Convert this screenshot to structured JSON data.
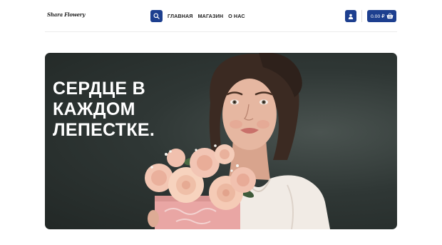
{
  "header": {
    "logo_text": "Shara Flowery",
    "nav": [
      "ГЛАВНАЯ",
      "МАГАЗИН",
      "О НАС"
    ],
    "cart_total": "0.00 ₽"
  },
  "hero": {
    "title_lines": [
      "СЕРДЦЕ В",
      "КАЖДОМ",
      "ЛЕПЕСТКЕ."
    ]
  },
  "icons": {
    "search": "search-icon",
    "account": "user-icon",
    "cart": "basket-icon"
  },
  "colors": {
    "accent": "#1d3f8f",
    "hero_background": "#2a312f",
    "text_dark": "#222222",
    "text_light": "#ffffff"
  }
}
